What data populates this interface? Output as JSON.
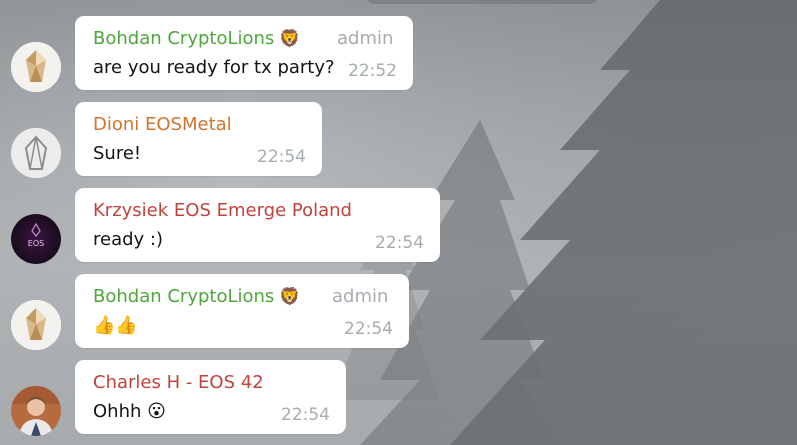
{
  "colors": {
    "green_sender": "#4da73a",
    "orange_sender": "#d2742f",
    "red_sender": "#c0433c",
    "meta_gray": "#a5acb2"
  },
  "messages": [
    {
      "sender": "Bohdan CryptoLions",
      "sender_emoji": "🦁",
      "role": "admin",
      "text": "are you ready for tx party?",
      "time": "22:52",
      "avatar": "cryptolions-crystal-avatar"
    },
    {
      "sender": "Dioni EOSMetal",
      "text": "Sure!",
      "time": "22:54",
      "avatar": "eosmetal-avatar"
    },
    {
      "sender": "Krzysiek EOS Emerge Poland",
      "text": "ready :)",
      "time": "22:54",
      "avatar": "eos-emerge-avatar",
      "avatar_text": "EOS"
    },
    {
      "sender": "Bohdan CryptoLions",
      "sender_emoji": "🦁",
      "role": "admin",
      "text": "👍👍",
      "time": "22:54",
      "avatar": "cryptolions-crystal-avatar"
    },
    {
      "sender": "Charles H - EOS 42",
      "text": "Ohhh 😮",
      "time": "22:54",
      "avatar": "person-photo-avatar"
    }
  ]
}
